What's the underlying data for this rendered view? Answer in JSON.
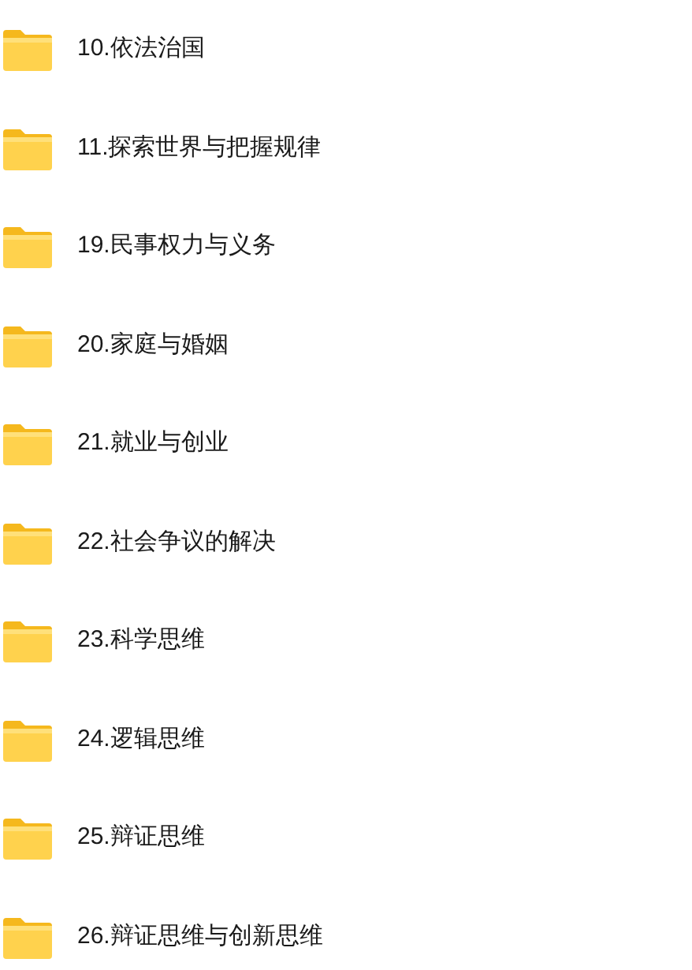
{
  "folders": [
    {
      "name": "10.依法治国"
    },
    {
      "name": "11.探索世界与把握规律"
    },
    {
      "name": "19.民事权力与义务"
    },
    {
      "name": "20.家庭与婚姻"
    },
    {
      "name": "21.就业与创业"
    },
    {
      "name": "22.社会争议的解决"
    },
    {
      "name": "23.科学思维"
    },
    {
      "name": "24.逻辑思维"
    },
    {
      "name": "25.辩证思维"
    },
    {
      "name": "26.辩证思维与创新思维"
    }
  ]
}
